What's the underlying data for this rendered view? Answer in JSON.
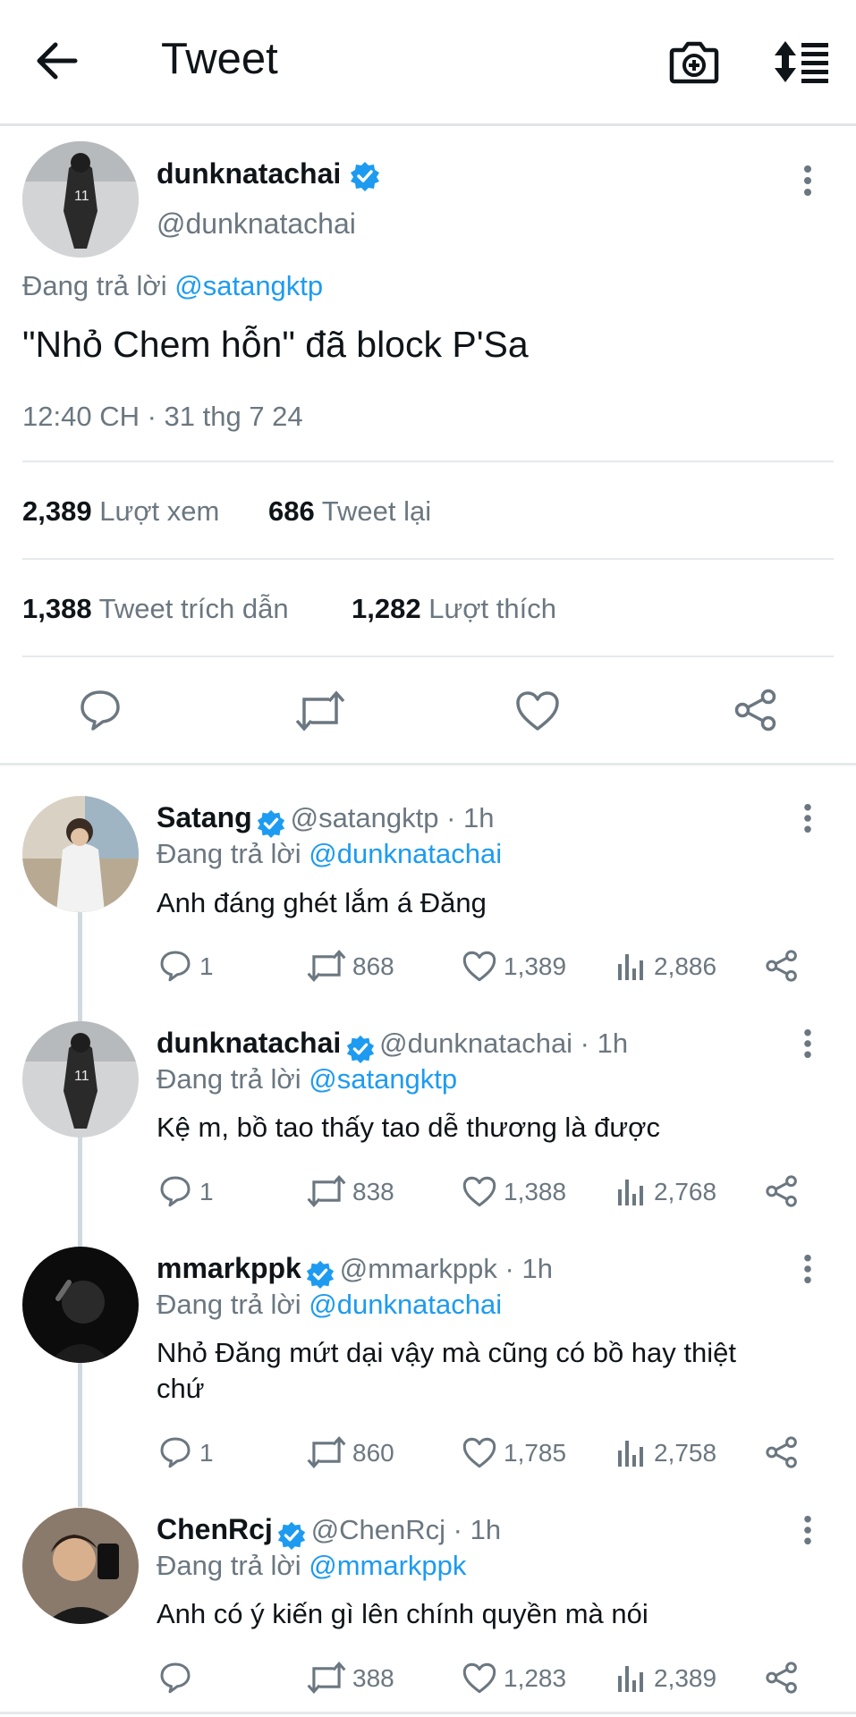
{
  "header": {
    "title": "Tweet",
    "back_icon": "arrow-left-icon",
    "camera_icon": "camera-add-icon",
    "sort_icon": "sort-lines-icon"
  },
  "tweet": {
    "name": "dunknatachai",
    "handle": "@dunknatachai",
    "reply_prefix": "Đang trả lời",
    "reply_to": "@satangktp",
    "text": "\"Nhỏ Chem hỗn\" đã block P'Sa",
    "timestamp": "12:40 CH · 31 thg 7 24",
    "views_count": "2,389",
    "views_label": "Lượt xem",
    "retweets_count": "686",
    "retweets_label": "Tweet lại",
    "quotes_count": "1,388",
    "quotes_label": "Tweet trích dẫn",
    "likes_count": "1,282",
    "likes_label": "Lượt thích"
  },
  "replies": [
    {
      "name": "Satang",
      "handle": "@satangktp · 1h",
      "reply_prefix": "Đang trả lời",
      "reply_to": "@dunknatachai",
      "text": "Anh đáng ghét lắm á Đăng",
      "replies": "1",
      "retweets": "868",
      "likes": "1,389",
      "views": "2,886"
    },
    {
      "name": "dunknatachai",
      "handle": "@dunknatachai · 1h",
      "reply_prefix": "Đang trả lời",
      "reply_to": "@satangktp",
      "text": "Kệ m, bồ tao thấy tao dễ thương là được",
      "replies": "1",
      "retweets": "838",
      "likes": "1,388",
      "views": "2,768"
    },
    {
      "name": "mmarkppk",
      "handle": "@mmarkppk · 1h",
      "reply_prefix": "Đang trả lời",
      "reply_to": "@dunknatachai",
      "text_line1": "Nhỏ Đăng mứt dại vậy mà cũng có bồ hay thiệt",
      "text_line2": "chứ",
      "replies": "1",
      "retweets": "860",
      "likes": "1,785",
      "views": "2,758"
    },
    {
      "name": "ChenRcj",
      "handle": "@ChenRcj · 1h",
      "reply_prefix": "Đang trả lời",
      "reply_to": "@mmarkppk",
      "text": "Anh có ý kiến gì lên chính quyền mà nói",
      "replies": "",
      "retweets": "388",
      "likes": "1,283",
      "views": "2,389"
    }
  ],
  "colors": {
    "accent": "#1d9bf0",
    "text": "#0f1419",
    "muted": "#6b7780",
    "divider": "#e6e9ec"
  }
}
